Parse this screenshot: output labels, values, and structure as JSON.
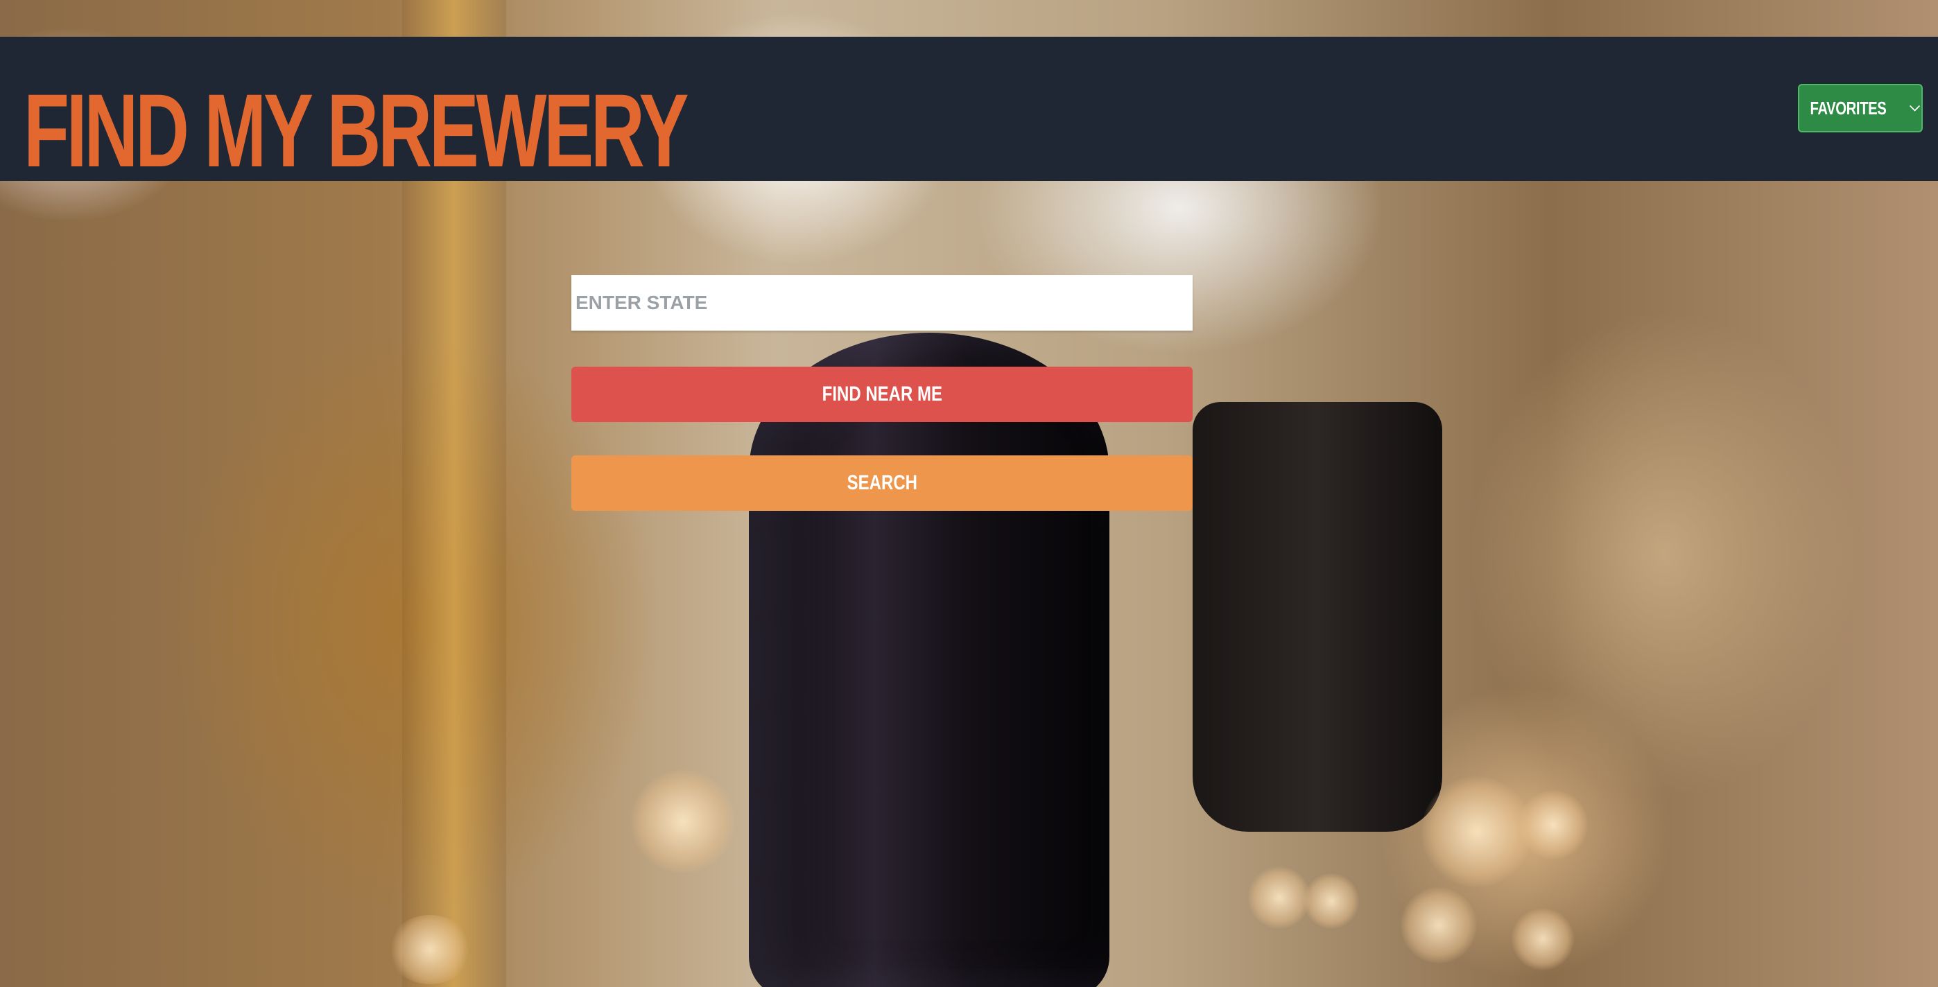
{
  "header": {
    "title": "FIND MY BREWERY",
    "favorites_label": "FAVORITES",
    "favorites_icon": "chevron-down-icon"
  },
  "search": {
    "placeholder": "ENTER STATE",
    "value": "",
    "find_near_me_label": "FIND NEAR ME",
    "search_label": "SEARCH"
  },
  "colors": {
    "navbar_bg": "#1f2735",
    "title": "#e26830",
    "favorites_bg": "#2d8b45",
    "find_near_me_bg": "#dd524d",
    "search_bg": "#ee964b"
  }
}
